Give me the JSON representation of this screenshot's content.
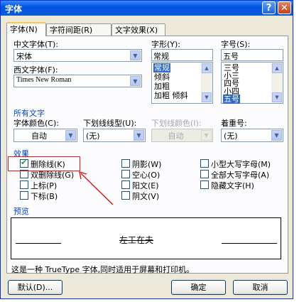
{
  "window": {
    "title": "字体",
    "help_label": "?",
    "close_label": "✕"
  },
  "tabs": [
    {
      "label": "字体(N)"
    },
    {
      "label": "字符间距(R)"
    },
    {
      "label": "文字效果(X)"
    }
  ],
  "font": {
    "cn_font_label": "中文字体(T):",
    "cn_font_value": "宋体",
    "en_font_label": "西文字体(F):",
    "en_font_value": "Times New Roman",
    "style_label": "字形(Y):",
    "style_value": "常规",
    "style_options": [
      "常规",
      "倾斜",
      "加粗",
      "加粗 倾斜"
    ],
    "size_label": "字号(S):",
    "size_value": "五号",
    "size_options": [
      "三号",
      "小三",
      "四号",
      "小四",
      "五号"
    ]
  },
  "all_text": {
    "section_title": "所有文字",
    "color_label": "字体颜色(C):",
    "color_value": "自动",
    "underline_label": "下划线线型(U):",
    "underline_value": "(无)",
    "underline_color_label": "下划线颜色(I):",
    "underline_color_value": "自动",
    "emphasis_label": "着重号:",
    "emphasis_value": "(无)"
  },
  "effects": {
    "section_title": "效果",
    "items": [
      {
        "label": "删除线(K)",
        "checked": true
      },
      {
        "label": "双删除线(G)",
        "checked": false
      },
      {
        "label": "上标(P)",
        "checked": false
      },
      {
        "label": "下标(B)",
        "checked": false
      },
      {
        "label": "阴影(W)",
        "checked": false
      },
      {
        "label": "空心(O)",
        "checked": false
      },
      {
        "label": "阳文(E)",
        "checked": false
      },
      {
        "label": "阴文(V)",
        "checked": false
      },
      {
        "label": "小型大写字母(M)",
        "checked": false
      },
      {
        "label": "全部大写字母(A)",
        "checked": false
      },
      {
        "label": "隐藏文字(H)",
        "checked": false
      }
    ]
  },
  "preview": {
    "section_title": "预览",
    "sample_text": "左工在夫"
  },
  "footer": {
    "note": "这是一种 TrueType 字体,同时适用于屏幕和打印机。",
    "default_label": "默认(D)...",
    "ok_label": "确定",
    "cancel_label": "取消"
  },
  "colors": {
    "title_bar": "#0054e3",
    "annotation": "#e11111",
    "selection": "#316ac5"
  }
}
